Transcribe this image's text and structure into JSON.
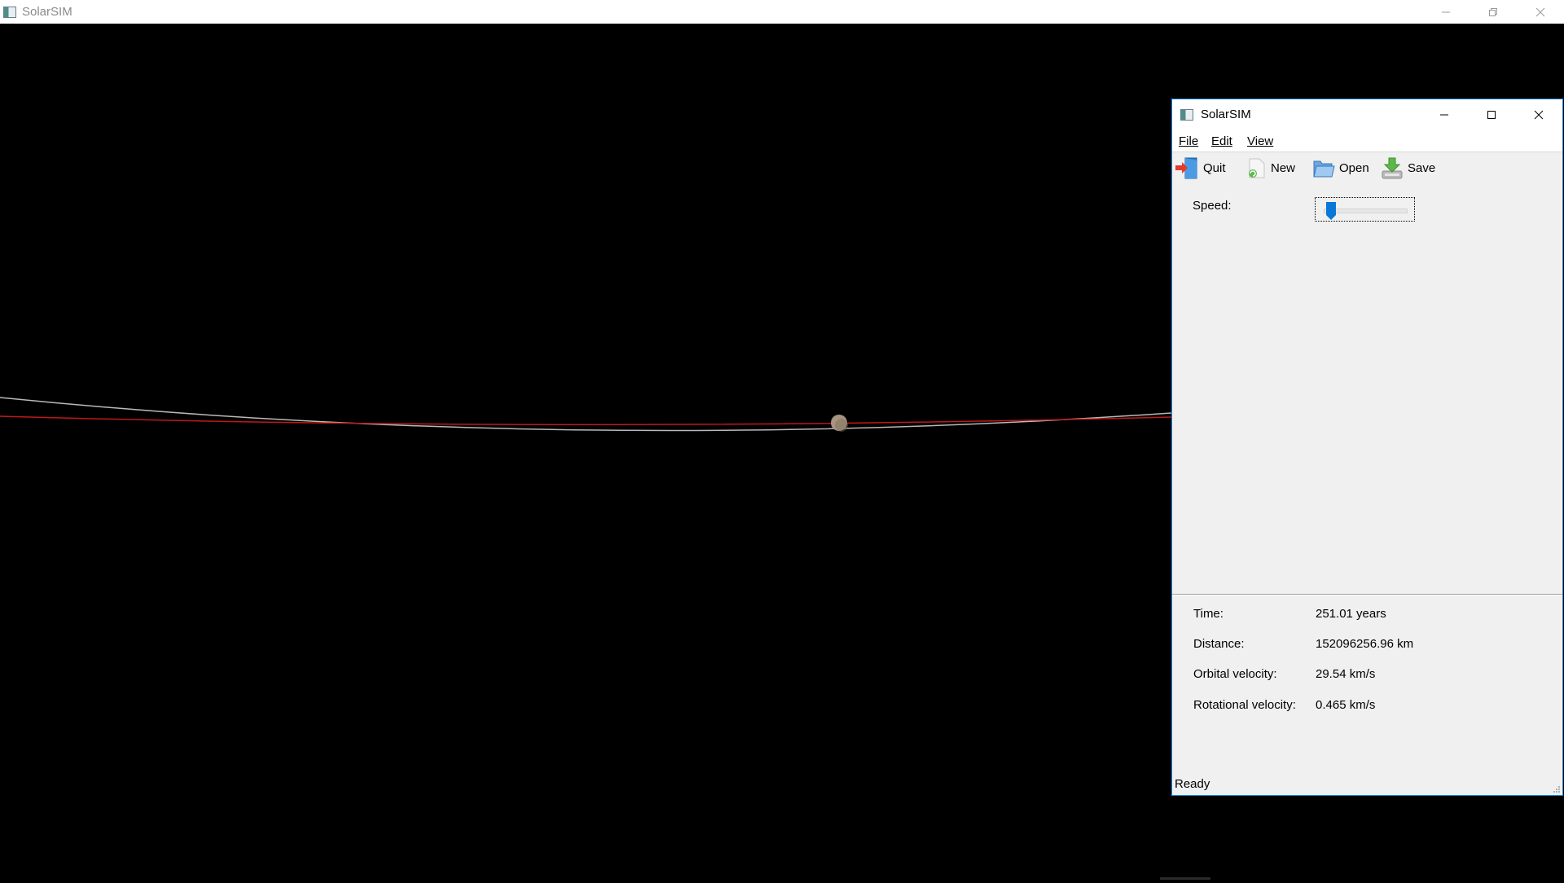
{
  "main_window": {
    "title": "SolarSIM",
    "background_color": "#000000"
  },
  "scene": {
    "orbit_colors": {
      "reference_orbit": "#b9b9b9",
      "trajectory": "#c01818"
    },
    "planet_color": "#a89580"
  },
  "control_window": {
    "title": "SolarSIM",
    "menu": [
      {
        "label": "File"
      },
      {
        "label": "Edit"
      },
      {
        "label": "View"
      }
    ],
    "toolbar": {
      "quit": {
        "label": "Quit",
        "icon": "quit-icon"
      },
      "new": {
        "label": "New",
        "icon": "new-icon"
      },
      "open": {
        "label": "Open",
        "icon": "folder-icon"
      },
      "save": {
        "label": "Save",
        "icon": "save-icon"
      }
    },
    "speed": {
      "label": "Speed:",
      "level": 0.05
    },
    "info": {
      "time": {
        "label": "Time:",
        "value": "251.01 years"
      },
      "distance": {
        "label": "Distance:",
        "value": "152096256.96 km"
      },
      "orbital_velocity": {
        "label": "Orbital velocity:",
        "value": "29.54 km/s"
      },
      "rotational_velocity": {
        "label": "Rotational velocity:",
        "value": "0.465 km/s"
      }
    },
    "status": "Ready"
  }
}
